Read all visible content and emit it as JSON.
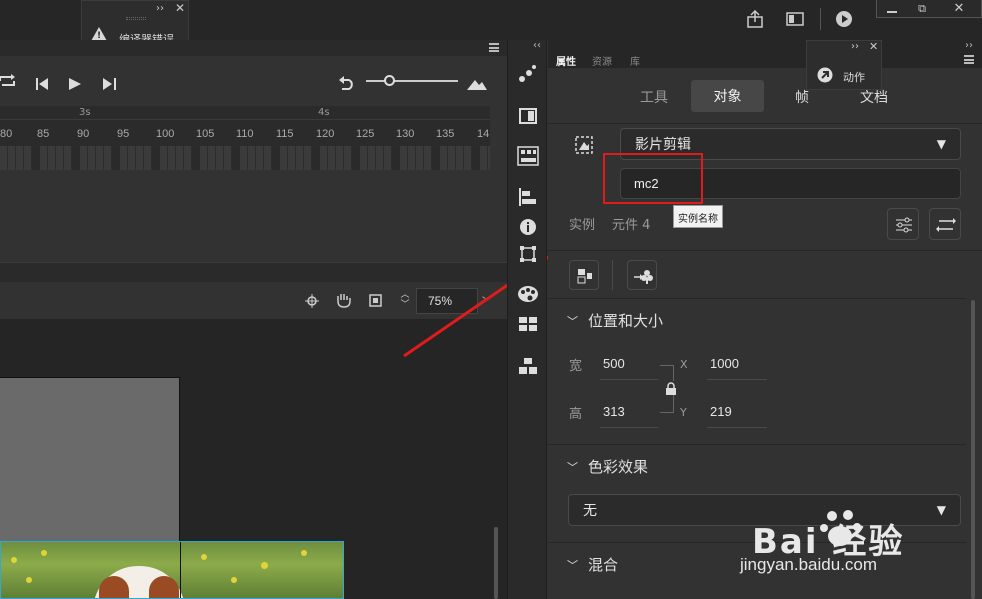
{
  "error_panel": {
    "title": "编译器错误"
  },
  "action_panel": {
    "title": "动作"
  },
  "timeline": {
    "seconds_markers": [
      "3s",
      "4s"
    ],
    "frame_ticks": [
      "80",
      "85",
      "90",
      "95",
      "100",
      "105",
      "110",
      "115",
      "120",
      "125",
      "130",
      "135",
      "14"
    ]
  },
  "stage": {
    "zoom": "75%"
  },
  "properties": {
    "tabs": [
      "属性",
      "资源",
      "库"
    ],
    "subtabs": [
      "工具",
      "对象",
      "帧",
      "文档"
    ],
    "active_subtab": "对象",
    "symbol_type": "影片剪辑",
    "instance_name_value": "mc2",
    "instance_label": "实例",
    "symbol_label": "元件 4",
    "tooltip": "实例名称",
    "position_section": {
      "title": "位置和大小",
      "width_label": "宽",
      "width": "500",
      "height_label": "高",
      "height": "313",
      "x_label": "X",
      "x": "1000",
      "y_label": "Y",
      "y": "219"
    },
    "color_section": {
      "title": "色彩效果",
      "value": "无"
    },
    "blend_section": {
      "title": "混合"
    }
  },
  "watermark": {
    "brand": "Bai 经验",
    "url": "jingyan.baidu.com"
  }
}
